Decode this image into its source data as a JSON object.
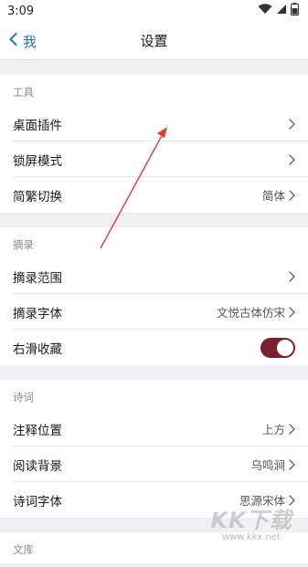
{
  "status_bar": {
    "time": "3:09"
  },
  "nav": {
    "back_label": "我",
    "title": "设置"
  },
  "sections": [
    {
      "header": "工具",
      "items": [
        {
          "label": "桌面插件",
          "value": ""
        },
        {
          "label": "锁屏模式",
          "value": ""
        },
        {
          "label": "简繁切换",
          "value": "简体"
        }
      ]
    },
    {
      "header": "摘录",
      "items": [
        {
          "label": "摘录范围",
          "value": ""
        },
        {
          "label": "摘录字体",
          "value": "文悦古体仿宋"
        },
        {
          "label": "右滑收藏",
          "toggle": true
        }
      ]
    },
    {
      "header": "诗词",
      "items": [
        {
          "label": "注释位置",
          "value": "上方"
        },
        {
          "label": "阅读背景",
          "value": "乌鸣涧"
        },
        {
          "label": "诗词字体",
          "value": "思源宋体"
        }
      ]
    },
    {
      "header": "文库",
      "items": []
    }
  ],
  "colors": {
    "accent": "#1976d2",
    "toggle_on": "#7b1f2a",
    "annotation_arrow": "#e53935"
  },
  "watermark": {
    "logo": "KK下载",
    "url": "www.kkx.net"
  }
}
